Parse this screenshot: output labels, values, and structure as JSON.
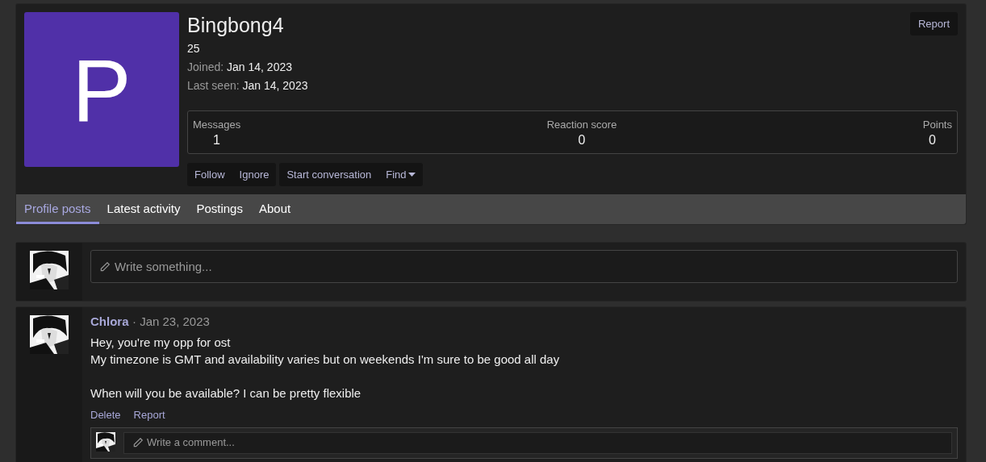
{
  "profile": {
    "avatar_letter": "P",
    "username": "Bingbong4",
    "subtitle": "25",
    "facts": [
      {
        "label": "Joined:",
        "value": "Jan 14, 2023"
      },
      {
        "label": "Last seen:",
        "value": "Jan 14, 2023"
      }
    ],
    "report": "Report",
    "stats": [
      {
        "label": "Messages",
        "value": "1"
      },
      {
        "label": "Reaction score",
        "value": "0"
      },
      {
        "label": "Points",
        "value": "0"
      }
    ],
    "button_groups": [
      [
        {
          "label": "Follow"
        },
        {
          "label": "Ignore"
        }
      ],
      [
        {
          "label": "Start conversation"
        },
        {
          "label": "Find",
          "dropdown": true
        }
      ]
    ]
  },
  "tabs": [
    {
      "label": "Profile posts",
      "selected": true
    },
    {
      "label": "Latest activity",
      "selected": false
    },
    {
      "label": "Postings",
      "selected": false
    },
    {
      "label": "About",
      "selected": false
    }
  ],
  "composer": {
    "placeholder": "Write something..."
  },
  "posts": [
    {
      "author": "Chlora",
      "date": "· Jan 23, 2023",
      "paragraphs": [
        [
          "Hey, you're my opp for ost",
          "My timezone is GMT and availability varies but on weekends I'm sure to be good all day"
        ],
        [
          "When will you be available? I can be pretty flexible"
        ]
      ],
      "actions": [
        "Delete",
        "Report"
      ],
      "comment_placeholder": "Write a comment..."
    }
  ]
}
